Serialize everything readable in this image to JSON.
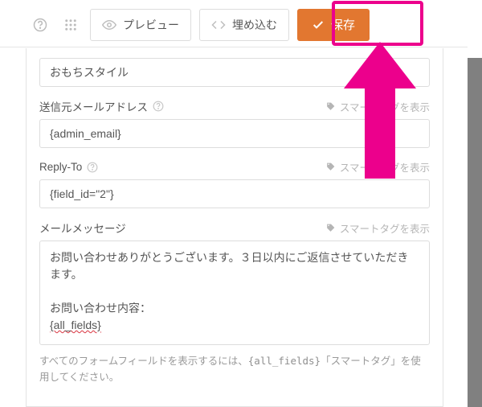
{
  "toolbar": {
    "preview_label": "プレビュー",
    "embed_label": "埋め込む",
    "save_label": "保存"
  },
  "fields": {
    "sender_name_value": "おもちスタイル",
    "from_email_label": "送信元メールアドレス",
    "from_email_value": "{admin_email}",
    "reply_to_label": "Reply-To",
    "reply_to_value": "{field_id=\"2\"}",
    "message_label": "メールメッセージ",
    "message_value_line1": "お問い合わせありがとうございます。３日以内にご返信させていただきます。",
    "message_value_line2": "お問い合わせ内容：",
    "message_value_line3": "{all_fields}"
  },
  "smart_tag_label": "スマートタグを表示",
  "hint_prefix": "すべてのフォームフィールドを表示するには、",
  "hint_code": "{all_fields}",
  "hint_suffix": "「スマートタグ」を使用してください。",
  "colors": {
    "accent": "#e27730",
    "highlight": "#ec008c"
  }
}
